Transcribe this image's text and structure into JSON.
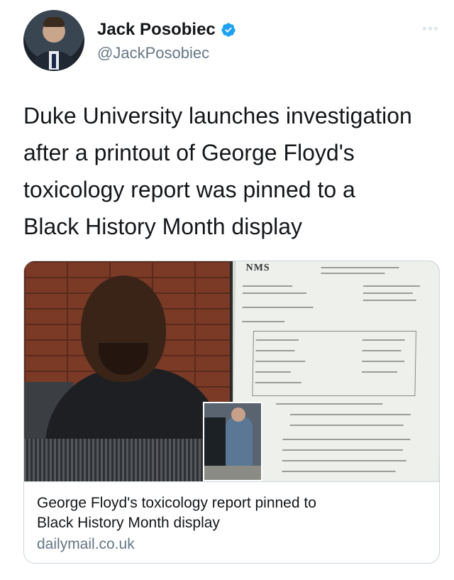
{
  "author": {
    "display_name": "Jack Posobiec",
    "handle": "@JackPosobiec",
    "verified": true,
    "avatar_icon": "profile-photo"
  },
  "more_icon": "more-dots-icon",
  "tweet": {
    "text_lines": [
      "Duke University launches investigation",
      "after a printout of George Floyd's",
      "toxicology report was pinned to a",
      "Black History Month display"
    ]
  },
  "link_card": {
    "title_lines": [
      "George Floyd's toxicology report pinned to",
      "Black History Month display"
    ],
    "domain": "dailymail.co.uk",
    "image_doc_logo": "NMS"
  },
  "colors": {
    "verified_blue": "#1da1f2",
    "secondary_text": "#657786",
    "border": "#ccd6dd"
  }
}
